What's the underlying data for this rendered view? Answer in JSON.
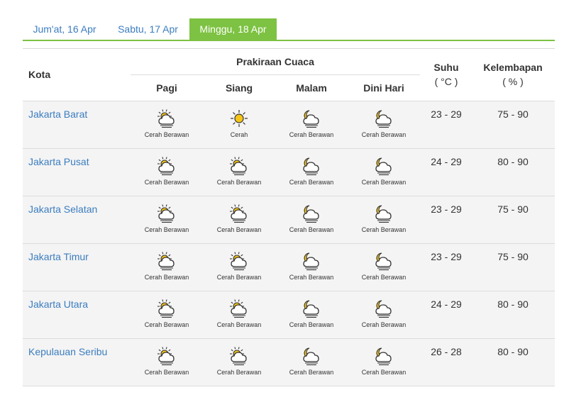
{
  "tabs": [
    {
      "label": "Jum'at, 16 Apr",
      "active": false
    },
    {
      "label": "Sabtu, 17 Apr",
      "active": false
    },
    {
      "label": "Minggu, 18 Apr",
      "active": true
    }
  ],
  "accent_color": "#7dc242",
  "link_color": "#3b7dbf",
  "headers": {
    "kota": "Kota",
    "prakiraan": "Prakiraan Cuaca",
    "pagi": "Pagi",
    "siang": "Siang",
    "malam": "Malam",
    "dini": "Dini Hari",
    "suhu": "Suhu",
    "suhu_unit": "( °C )",
    "kelembapan": "Kelembapan",
    "kelembapan_unit": "( % )"
  },
  "rows": [
    {
      "city": "Jakarta Barat",
      "pagi": {
        "label": "Cerah Berawan",
        "icon": "partly-cloudy-day-icon"
      },
      "siang": {
        "label": "Cerah",
        "icon": "sunny-icon"
      },
      "malam": {
        "label": "Cerah Berawan",
        "icon": "partly-cloudy-night-icon"
      },
      "dini": {
        "label": "Cerah Berawan",
        "icon": "partly-cloudy-night-icon"
      },
      "suhu": "23 - 29",
      "kelembapan": "75 - 90"
    },
    {
      "city": "Jakarta Pusat",
      "pagi": {
        "label": "Cerah Berawan",
        "icon": "partly-cloudy-day-icon"
      },
      "siang": {
        "label": "Cerah Berawan",
        "icon": "partly-cloudy-day-icon"
      },
      "malam": {
        "label": "Cerah Berawan",
        "icon": "partly-cloudy-night-icon"
      },
      "dini": {
        "label": "Cerah Berawan",
        "icon": "partly-cloudy-night-icon"
      },
      "suhu": "24 - 29",
      "kelembapan": "80 - 90"
    },
    {
      "city": "Jakarta Selatan",
      "pagi": {
        "label": "Cerah Berawan",
        "icon": "partly-cloudy-day-icon"
      },
      "siang": {
        "label": "Cerah Berawan",
        "icon": "partly-cloudy-day-icon"
      },
      "malam": {
        "label": "Cerah Berawan",
        "icon": "partly-cloudy-night-icon"
      },
      "dini": {
        "label": "Cerah Berawan",
        "icon": "partly-cloudy-night-icon"
      },
      "suhu": "23 - 29",
      "kelembapan": "75 - 90"
    },
    {
      "city": "Jakarta Timur",
      "pagi": {
        "label": "Cerah Berawan",
        "icon": "partly-cloudy-day-icon"
      },
      "siang": {
        "label": "Cerah Berawan",
        "icon": "partly-cloudy-day-icon"
      },
      "malam": {
        "label": "Cerah Berawan",
        "icon": "partly-cloudy-night-icon"
      },
      "dini": {
        "label": "Cerah Berawan",
        "icon": "partly-cloudy-night-icon"
      },
      "suhu": "23 - 29",
      "kelembapan": "75 - 90"
    },
    {
      "city": "Jakarta Utara",
      "pagi": {
        "label": "Cerah Berawan",
        "icon": "partly-cloudy-day-icon"
      },
      "siang": {
        "label": "Cerah Berawan",
        "icon": "partly-cloudy-day-icon"
      },
      "malam": {
        "label": "Cerah Berawan",
        "icon": "partly-cloudy-night-icon"
      },
      "dini": {
        "label": "Cerah Berawan",
        "icon": "partly-cloudy-night-icon"
      },
      "suhu": "24 - 29",
      "kelembapan": "80 - 90"
    },
    {
      "city": "Kepulauan Seribu",
      "pagi": {
        "label": "Cerah Berawan",
        "icon": "partly-cloudy-day-icon"
      },
      "siang": {
        "label": "Cerah Berawan",
        "icon": "partly-cloudy-day-icon"
      },
      "malam": {
        "label": "Cerah Berawan",
        "icon": "partly-cloudy-night-icon"
      },
      "dini": {
        "label": "Cerah Berawan",
        "icon": "partly-cloudy-night-icon"
      },
      "suhu": "26 - 28",
      "kelembapan": "80 - 90"
    }
  ]
}
